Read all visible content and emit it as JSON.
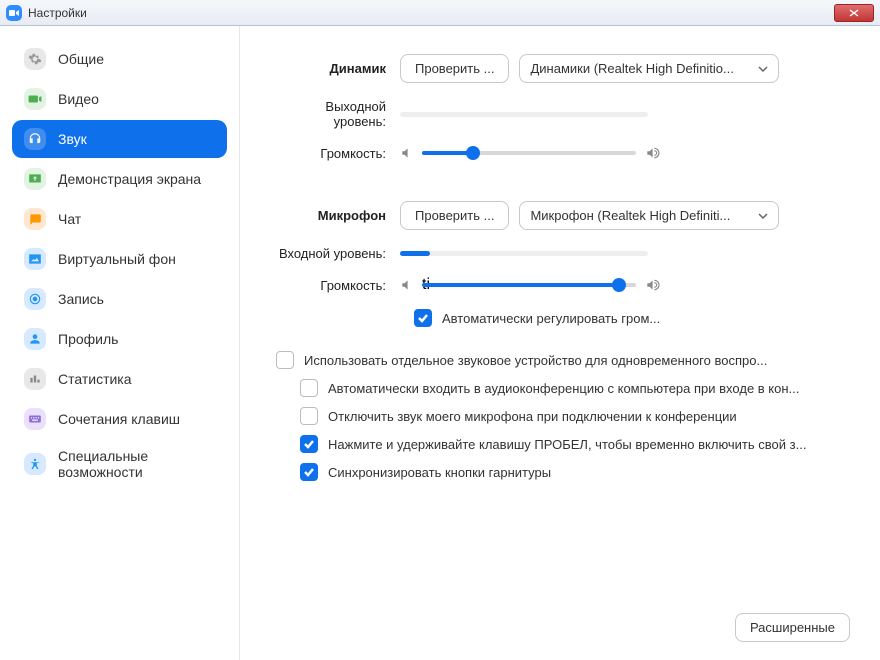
{
  "window": {
    "title": "Настройки"
  },
  "sidebar": {
    "items": [
      {
        "label": "Общие"
      },
      {
        "label": "Видео"
      },
      {
        "label": "Звук"
      },
      {
        "label": "Демонстрация экрана"
      },
      {
        "label": "Чат"
      },
      {
        "label": "Виртуальный фон"
      },
      {
        "label": "Запись"
      },
      {
        "label": "Профиль"
      },
      {
        "label": "Статистика"
      },
      {
        "label": "Сочетания клавиш"
      },
      {
        "label": "Специальные возможности"
      }
    ]
  },
  "speaker": {
    "heading": "Динамик",
    "test_btn": "Проверить ...",
    "device": "Динамики (Realtek High Definitio...",
    "output_label": "Выходной уровень:",
    "volume_label": "Громкость:",
    "volume_pct": 24
  },
  "mic": {
    "heading": "Микрофон",
    "test_btn": "Проверить ...",
    "device": "Микрофон (Realtek High Definiti...",
    "input_label": "Входной уровень:",
    "input_pct": 12,
    "volume_label": "Громкость:",
    "volume_pct": 92,
    "auto_adjust": "Автоматически регулировать гром...",
    "auto_adjust_checked": true
  },
  "options": {
    "separate_device": "Использовать отдельное звуковое устройство для одновременного воспро...",
    "separate_device_checked": false,
    "auto_join": "Автоматически входить в аудиоконференцию с компьютера при входе в кон...",
    "auto_join_checked": false,
    "mute_on_join": "Отключить звук моего микрофона при подключении к конференции",
    "mute_on_join_checked": false,
    "push_to_talk": "Нажмите и удерживайте клавишу ПРОБЕЛ, чтобы временно включить свой з...",
    "push_to_talk_checked": true,
    "sync_headset": "Синхронизировать кнопки гарнитуры",
    "sync_headset_checked": true
  },
  "footer": {
    "advanced": "Расширенные"
  }
}
